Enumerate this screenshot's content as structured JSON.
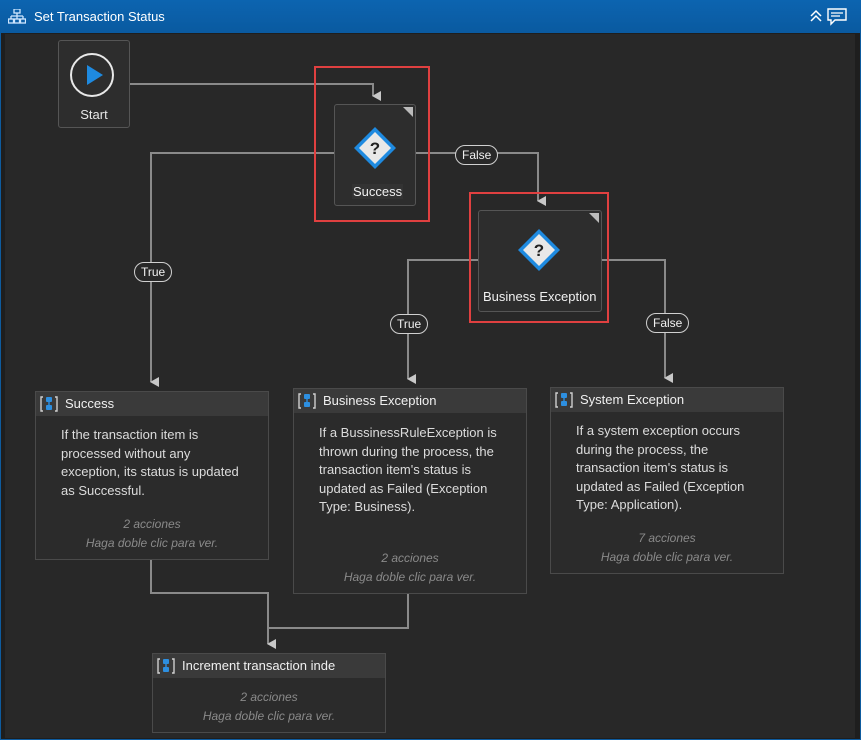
{
  "window": {
    "title": "Set Transaction Status"
  },
  "start": {
    "label": "Start"
  },
  "decisions": {
    "success": {
      "label": "Success"
    },
    "business_exception": {
      "label": "Business Exception"
    }
  },
  "connectors": {
    "success_true": "True",
    "success_false": "False",
    "business_true": "True",
    "business_false": "False"
  },
  "sequences": {
    "success": {
      "title": "Success",
      "description": "If the transaction item is processed without any exception, its status is updated as Successful.",
      "count": "2 acciones",
      "hint": "Haga doble clic para ver."
    },
    "business_exception": {
      "title": "Business Exception",
      "description": "If a BussinessRuleException is thrown during the process, the transaction item's status is updated as Failed (Exception Type: Business).",
      "count": "2 acciones",
      "hint": "Haga doble clic para ver."
    },
    "system_exception": {
      "title": "System Exception",
      "description": "If a system exception occurs during the process, the transaction item's status is updated as Failed (Exception Type: Application).",
      "count": "7 acciones",
      "hint": "Haga doble clic para ver."
    },
    "increment": {
      "title": "Increment transaction inde",
      "count": "2 acciones",
      "hint": "Haga doble clic para ver."
    }
  },
  "colors": {
    "title_bar": "#0a5aa0",
    "canvas": "#282828",
    "highlight": "#e04040",
    "diamond_blue": "#1e8ae0",
    "seq_icon_blue": "#2d8fe0"
  }
}
